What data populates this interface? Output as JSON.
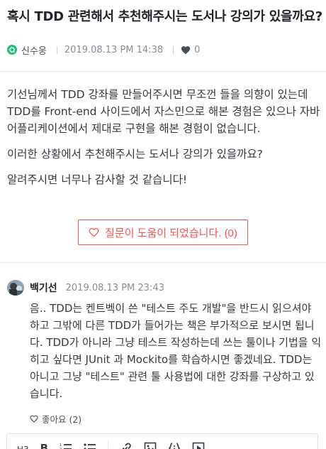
{
  "question": {
    "title": "혹시 TDD 관련해서 추천해주시는 도서나 강의가 있을까요?",
    "author": "신수웅",
    "date": "2019.08.13 PM 14:38",
    "like_count": "0",
    "body": [
      "기선님께서 TDD 강좌를 만들어주시면 무조껀 들을 의향이 있는데",
      "TDD를 Front-end 사이드에서 자스민으로 해본 경험은 있으나 자바",
      "어플리케이션에서 제대로 구현을 해본 경험이 없습니다.",
      "이러한 상황에서 추천해주시는 도서나 강의가 있을까요?",
      "알려주시면 너무나 감사할 것 같습니다!"
    ],
    "helpful_label": "질문이 도움이 되었습니다. (0)"
  },
  "answer": {
    "author": "백기선",
    "date": "2019.08.13 PM 23:43",
    "body": [
      "음.. TDD는 켄트벡이 쓴 \"테스트 주도 개발\"을 반드시 읽으셔야",
      "하고 그밖에 다른 TDD가 들어가는 책은 부가적으로 보시면 됩니",
      "다. TDD가 아니라 그냥 테스트 작성하는데 쓰는 툴이나 기법을 익",
      "히고 싶다면 JUnit 과 Mockito를 학습하시면 좋겠네요. TDD는",
      "아니고 그냥 \"테스트\" 관련 툴 사용법에 대한 강좌를 구상하고 있",
      "습니다."
    ],
    "like_label": "좋아요 (2)"
  },
  "toolbar": {
    "heading_label": "H3",
    "bold_label": "B",
    "icons": [
      "ordered-list-icon",
      "bullet-list-icon",
      "link-icon",
      "image-icon",
      "code-block-icon",
      "video-icon"
    ]
  },
  "colors": {
    "brand_green": "#1dc078",
    "accent_red": "#fa5252",
    "muted_text": "#868e96"
  }
}
